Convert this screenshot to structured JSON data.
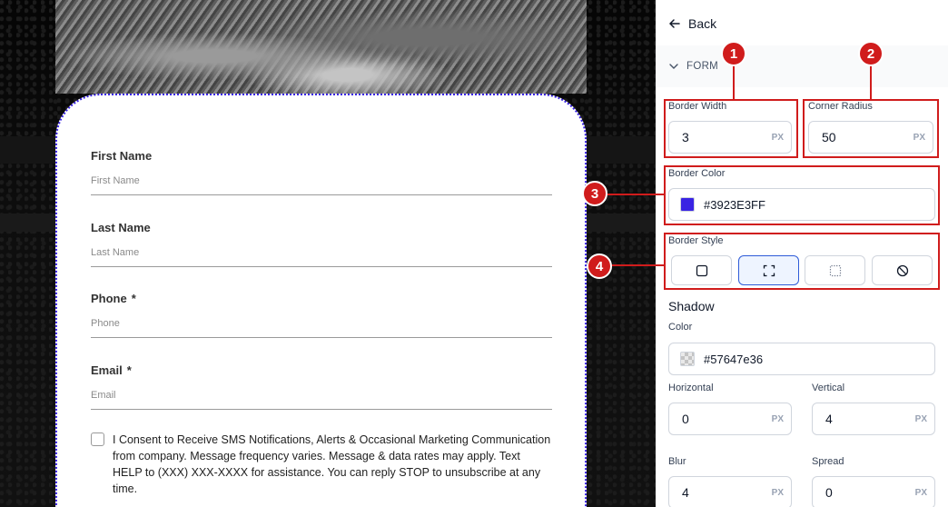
{
  "back_label": "Back",
  "section": {
    "title": "FORM"
  },
  "border_width": {
    "label": "Border Width",
    "value": "3",
    "unit": "PX"
  },
  "corner_radius": {
    "label": "Corner Radius",
    "value": "50",
    "unit": "PX"
  },
  "border_color": {
    "label": "Border Color",
    "value": "#3923E3FF",
    "swatch": "#3923e3"
  },
  "border_style": {
    "label": "Border Style",
    "options": [
      "solid-square-icon",
      "dashed-corners-icon",
      "dotted-square-icon",
      "none-icon"
    ],
    "selected": 1
  },
  "shadow": {
    "title": "Shadow",
    "color_label": "Color",
    "color_value": "#57647e36",
    "horizontal": {
      "label": "Horizontal",
      "value": "0",
      "unit": "PX"
    },
    "vertical": {
      "label": "Vertical",
      "value": "4",
      "unit": "PX"
    },
    "blur": {
      "label": "Blur",
      "value": "4",
      "unit": "PX"
    },
    "spread": {
      "label": "Spread",
      "value": "0",
      "unit": "PX"
    }
  },
  "form": {
    "first_name": {
      "label": "First Name",
      "placeholder": "First Name"
    },
    "last_name": {
      "label": "Last Name",
      "placeholder": "Last Name"
    },
    "phone": {
      "label": "Phone",
      "required": "*",
      "placeholder": "Phone"
    },
    "email": {
      "label": "Email",
      "required": "*",
      "placeholder": "Email"
    },
    "consent": "I Consent to Receive SMS Notifications, Alerts & Occasional Marketing Communication from company. Message frequency varies. Message & data rates may apply. Text HELP to (XXX) XXX-XXXX for assistance. You can reply STOP to unsubscribe at any time."
  },
  "annotations": [
    "1",
    "2",
    "3",
    "4"
  ],
  "colors": {
    "accent": "#3923e3",
    "annotation": "#d01c1c",
    "active_bg": "#eef4ff"
  }
}
